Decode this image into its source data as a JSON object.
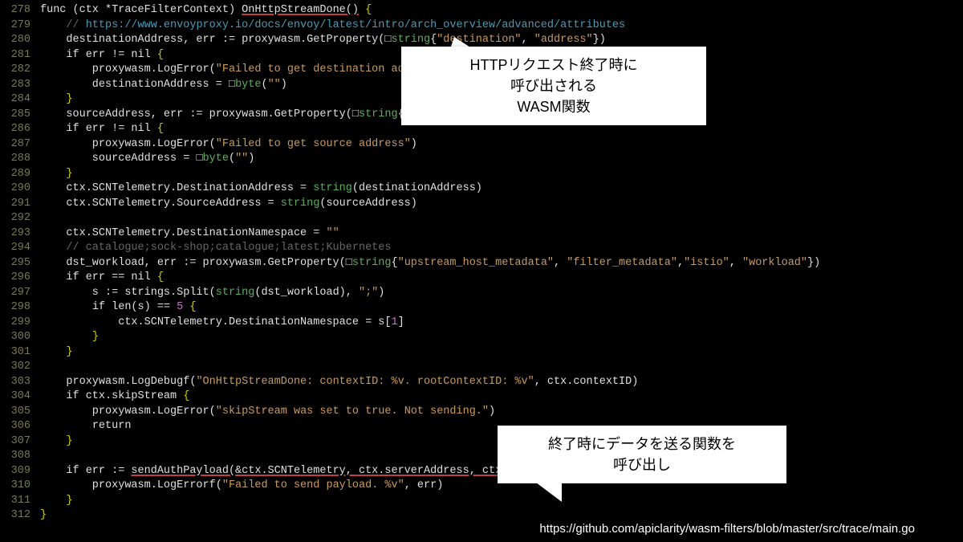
{
  "lines": [
    {
      "n": 278,
      "html": "<span class='kw'>func</span> (ctx *TraceFilterContext) <span class='redunder'>OnHttpStreamDone()</span> <span class='br'>{</span>"
    },
    {
      "n": 279,
      "html": "    <span class='cmt'>// </span><span class='cmtlink'>https://www.envoyproxy.io/docs/envoy/latest/intro/arch_overview/advanced/attributes</span>"
    },
    {
      "n": 280,
      "html": "    destinationAddress, err := proxywasm.GetProperty(<span class='sq'>□</span><span class='typ'>string</span>{<span class='str'>\"destination\"</span>, <span class='str'>\"address\"</span>})"
    },
    {
      "n": 281,
      "html": "    <span class='kw'>if</span> err != <span class='kw'>nil</span> <span class='br'>{</span>"
    },
    {
      "n": 282,
      "html": "        proxywasm.LogError(<span class='str'>\"Failed to get destination address\"</span>)"
    },
    {
      "n": 283,
      "html": "        destinationAddress = <span class='sq'>□</span><span class='typ'>byte</span>(<span class='str'>\"\"</span>)"
    },
    {
      "n": 284,
      "html": "    <span class='br'>}</span>"
    },
    {
      "n": 285,
      "html": "    sourceAddress, err := proxywasm.GetProperty(<span class='sq'>□</span><span class='typ'>string</span>{<span class='str'>\"source\"</span>, <span class='str'>\"address\"</span>})"
    },
    {
      "n": 286,
      "html": "    <span class='kw'>if</span> err != <span class='kw'>nil</span> <span class='br'>{</span>"
    },
    {
      "n": 287,
      "html": "        proxywasm.LogError(<span class='str'>\"Failed to get source address\"</span>)"
    },
    {
      "n": 288,
      "html": "        sourceAddress = <span class='sq'>□</span><span class='typ'>byte</span>(<span class='str'>\"\"</span>)"
    },
    {
      "n": 289,
      "html": "    <span class='br'>}</span>"
    },
    {
      "n": 290,
      "html": "    ctx.SCNTelemetry.DestinationAddress = <span class='typ'>string</span>(destinationAddress)"
    },
    {
      "n": 291,
      "html": "    ctx.SCNTelemetry.SourceAddress = <span class='typ'>string</span>(sourceAddress)"
    },
    {
      "n": 292,
      "html": ""
    },
    {
      "n": 293,
      "html": "    ctx.SCNTelemetry.DestinationNamespace = <span class='str'>\"\"</span>"
    },
    {
      "n": 294,
      "html": "    <span class='cmt'>// catalogue;sock-shop;catalogue;latest;Kubernetes</span>"
    },
    {
      "n": 295,
      "html": "    dst_workload, err := proxywasm.GetProperty(<span class='sq'>□</span><span class='typ'>string</span>{<span class='str'>\"upstream_host_metadata\"</span>, <span class='str'>\"filter_metadata\"</span>,<span class='str'>\"istio\"</span>, <span class='str'>\"workload\"</span>})"
    },
    {
      "n": 296,
      "html": "    <span class='kw'>if</span> err == <span class='kw'>nil</span> <span class='br'>{</span>"
    },
    {
      "n": 297,
      "html": "        s := strings.Split(<span class='typ'>string</span>(dst_workload), <span class='str'>\";\"</span>)"
    },
    {
      "n": 298,
      "html": "        <span class='kw'>if</span> len(s) == <span class='num'>5</span> <span class='br'>{</span>"
    },
    {
      "n": 299,
      "html": "            ctx.SCNTelemetry.DestinationNamespace = s[<span class='num'>1</span>]"
    },
    {
      "n": 300,
      "html": "        <span class='br'>}</span>"
    },
    {
      "n": 301,
      "html": "    <span class='br'>}</span>"
    },
    {
      "n": 302,
      "html": ""
    },
    {
      "n": 303,
      "html": "    proxywasm.LogDebugf(<span class='str'>\"OnHttpStreamDone: contextID: %v. rootContextID: %v\"</span>, ctx.contextID)"
    },
    {
      "n": 304,
      "html": "    <span class='kw'>if</span> ctx.skipStream <span class='br'>{</span>"
    },
    {
      "n": 305,
      "html": "        proxywasm.LogError(<span class='str'>\"skipStream was set to true. Not sending.\"</span>)"
    },
    {
      "n": 306,
      "html": "        <span class='kw'>return</span>"
    },
    {
      "n": 307,
      "html": "    <span class='br'>}</span>"
    },
    {
      "n": 308,
      "html": ""
    },
    {
      "n": 309,
      "html": "    <span class='kw'>if</span> err := <span class='redunder'>sendAuthPayload(&ctx.SCNTelemetry, ctx.serverAddress, ctx.scnNATSSubject)</span>; err != <span class='kw'>nil</span> <span class='br'>{</span>"
    },
    {
      "n": 310,
      "html": "        proxywasm.LogErrorf(<span class='str'>\"Failed to send payload. %v\"</span>, err)"
    },
    {
      "n": 311,
      "html": "    <span class='br'>}</span>"
    },
    {
      "n": 312,
      "html": "<span class='br'>}</span>"
    }
  ],
  "callout1": {
    "line1": "HTTPリクエスト終了時に",
    "line2": "呼び出される",
    "line3": "WASM関数"
  },
  "callout2": {
    "line1": "終了時にデータを送る関数を",
    "line2": "呼び出し"
  },
  "source_url": "https://github.com/apiclarity/wasm-filters/blob/master/src/trace/main.go"
}
